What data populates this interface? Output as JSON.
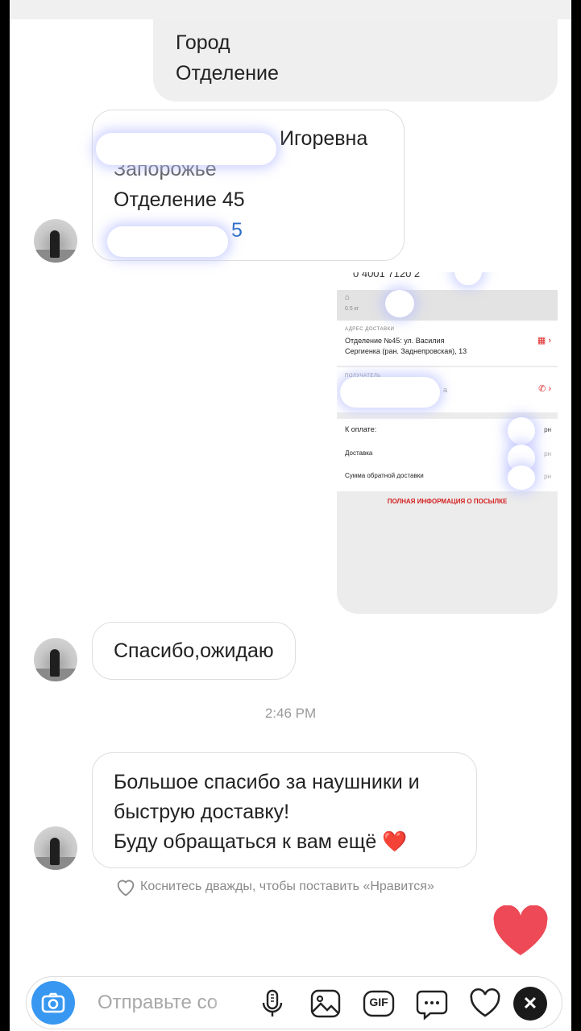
{
  "messages": {
    "outgoing_form": {
      "line1": "Город",
      "line2": "Отделение"
    },
    "address": {
      "name_visible": "Игоревна",
      "city": "Запорожье",
      "branch": "Отделение 45",
      "phone_visible": "5"
    },
    "screenshot": {
      "top_partial": "0 4001 7120 2",
      "header_weight": "0.5 кг",
      "delivery_caption": "АДРЕС ДОСТАВКИ",
      "delivery_line1": "Отделение №45: ул. Василия",
      "delivery_line2": "Сергиенка (ран. Заднепровская), 13",
      "recipient_caption": "ПОЛУЧАТЕЛЬ",
      "recipient_tail": "а",
      "row1_label": "К оплате:",
      "row1_value": "рн",
      "row2_label": "Доставка",
      "row2_value": "рн",
      "row3_label": "Сумма обратной доставки",
      "row3_value": "рн",
      "full_info": "ПОЛНАЯ ИНФОРМАЦИЯ О ПОСЫЛКЕ"
    },
    "reply1": "Спасибо,ожидаю",
    "timestamp": "2:46 PM",
    "thanks_line1": "Большое спасибо за наушники и",
    "thanks_line2": "быструю доставку!",
    "thanks_line3": "Буду обращаться к вам ещё",
    "thanks_emoji": "❤️",
    "like_hint": "Коснитесь дважды, чтобы поставить «Нравится»"
  },
  "composer": {
    "placeholder": "Отправьте со",
    "gif_label": "GIF",
    "close_symbol": "✕"
  },
  "icons": [
    "camera-icon",
    "microphone-icon",
    "gallery-icon",
    "gif-icon",
    "sticker-icon",
    "heart-icon",
    "close-icon"
  ],
  "colors": {
    "accent": "#3897f0",
    "heart": "#ed4956",
    "link": "#2d6ec7"
  }
}
